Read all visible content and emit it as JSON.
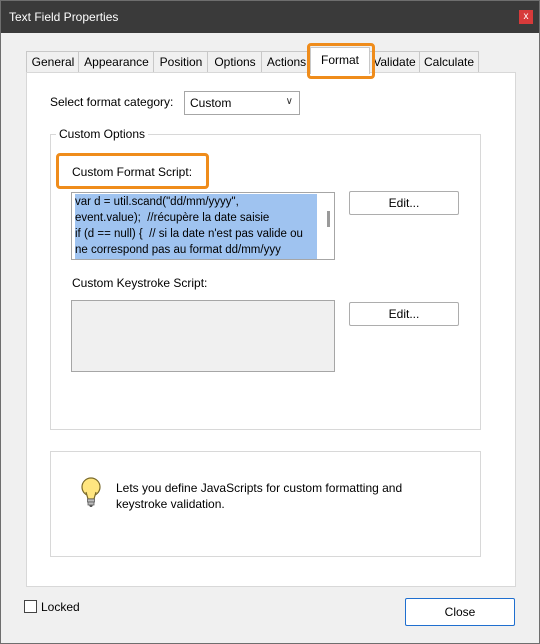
{
  "window": {
    "title": "Text Field Properties",
    "close_label": "x"
  },
  "tabs": [
    {
      "label": "General"
    },
    {
      "label": "Appearance"
    },
    {
      "label": "Position"
    },
    {
      "label": "Options"
    },
    {
      "label": "Actions"
    },
    {
      "label": "Format"
    },
    {
      "label": "Validate"
    },
    {
      "label": "Calculate"
    }
  ],
  "active_tab": "Format",
  "format": {
    "category_label": "Select format category:",
    "category_value": "Custom"
  },
  "custom_options": {
    "group_title": "Custom Options",
    "format_script_label": "Custom Format Script:",
    "format_script_text": "var d = util.scand(\"dd/mm/yyyy\",\nevent.value);  //récupère la date saisie\nif (d == null) {  // si la date n'est pas valide ou\nne correspond pas au format dd/mm/yyy\n              app.alert(\"Merci de saisir une date",
    "format_edit_button": "Edit...",
    "keystroke_script_label": "Custom Keystroke Script:",
    "keystroke_script_text": "",
    "keystroke_edit_button": "Edit..."
  },
  "info": {
    "text": "Lets you define JavaScripts for custom formatting and keystroke validation."
  },
  "footer": {
    "locked_label": "Locked",
    "locked_checked": false,
    "close_button": "Close"
  },
  "colors": {
    "highlight_box": "#ef8c1b",
    "selection": "#9fc3f0",
    "titlebar": "#3a3a3a"
  }
}
